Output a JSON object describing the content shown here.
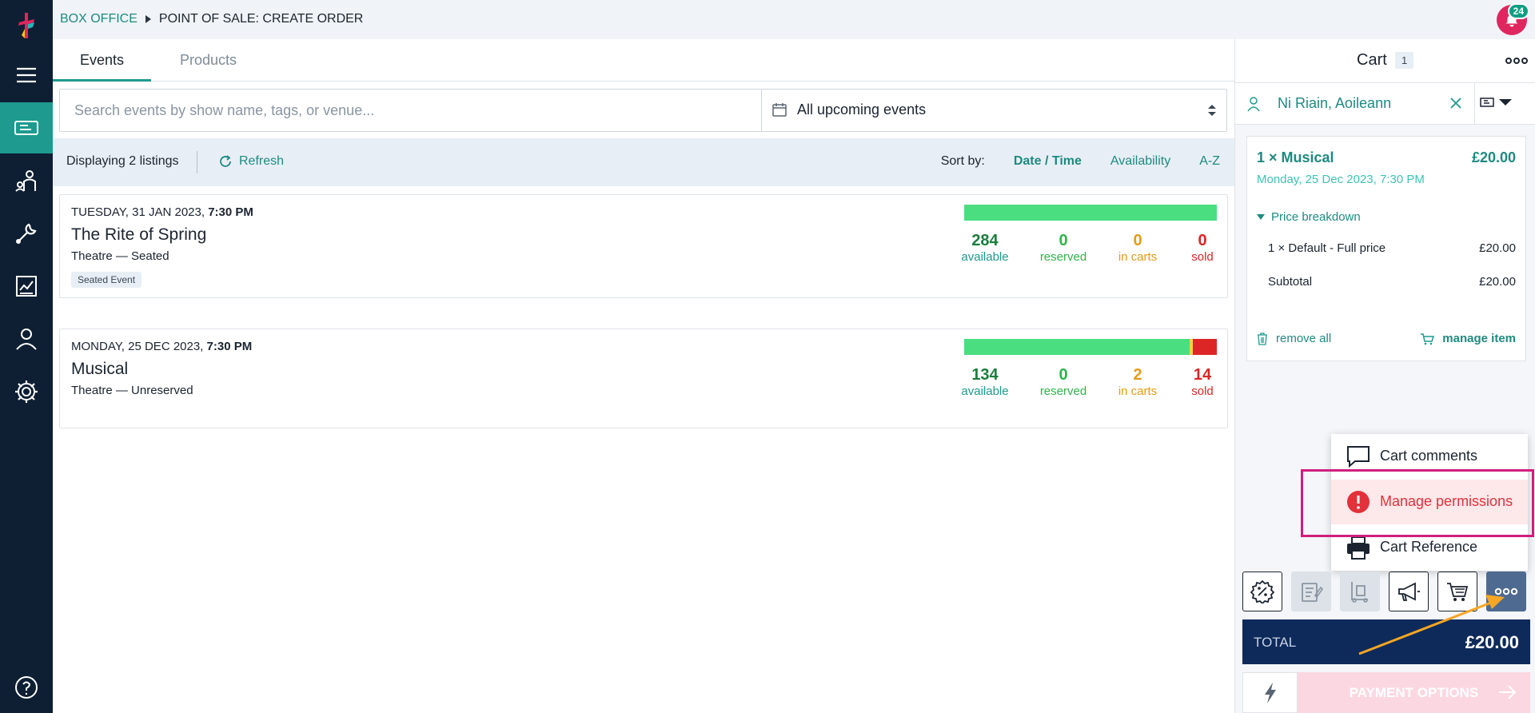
{
  "breadcrumb": {
    "root": "BOX OFFICE",
    "current": "POINT OF SALE: CREATE ORDER"
  },
  "notifications": {
    "count": "24"
  },
  "tabs": [
    {
      "label": "Events"
    },
    {
      "label": "Products"
    }
  ],
  "search": {
    "placeholder": "Search events by show name, tags, or venue...",
    "value": ""
  },
  "filter": {
    "selected": "All upcoming events"
  },
  "listing": {
    "count_text": "Displaying 2 listings",
    "refresh_label": "Refresh",
    "sort_label": "Sort by:",
    "sort_options": [
      "Date / Time",
      "Availability",
      "A-Z"
    ]
  },
  "events": [
    {
      "date_text": "TUESDAY, 31 JAN 2023,",
      "time": "7:30 PM",
      "title": "The Rite of Spring",
      "venue": "Theatre — Seated",
      "tag": "Seated Event",
      "stats": {
        "available": "284",
        "reserved": "0",
        "in_carts": "0",
        "sold": "0"
      },
      "capacity": {
        "available": 284,
        "in_carts": 0,
        "sold": 0
      }
    },
    {
      "date_text": "MONDAY, 25 DEC 2023,",
      "time": "7:30 PM",
      "title": "Musical",
      "venue": "Theatre — Unreserved",
      "tag": "",
      "stats": {
        "available": "134",
        "reserved": "0",
        "in_carts": "2",
        "sold": "14"
      },
      "capacity": {
        "available": 134,
        "in_carts": 2,
        "sold": 14
      }
    }
  ],
  "stat_labels": {
    "available": "available",
    "reserved": "reserved",
    "in_carts": "in carts",
    "sold": "sold"
  },
  "cart": {
    "title": "Cart",
    "count": "1",
    "customer": "Ni Riain, Aoileann",
    "item": {
      "name": "1 × Musical",
      "price": "£20.00",
      "date": "Monday, 25 Dec 2023, 7:30 PM",
      "breakdown_label": "Price breakdown",
      "line_label": "1 × Default - Full price",
      "line_price": "£20.00",
      "subtotal_label": "Subtotal",
      "subtotal": "£20.00",
      "remove_label": "remove all",
      "manage_label": "manage item"
    },
    "menu": [
      {
        "label": "Cart comments",
        "icon": "comment-icon"
      },
      {
        "label": "Manage permissions",
        "icon": "alert-icon"
      },
      {
        "label": "Cart Reference",
        "icon": "printer-icon"
      }
    ],
    "total_label": "TOTAL",
    "total_value": "£20.00",
    "payment_label": "PAYMENT OPTIONS"
  },
  "colors": {
    "sidebar": "#0e1f33",
    "accent": "#1e9a8e",
    "available": "#4ade80",
    "in_carts": "#f5d142",
    "sold": "#dc2626",
    "total": "#0e2a5b",
    "highlight": "#d01e7b",
    "annotation_arrow": "#f5a623"
  }
}
